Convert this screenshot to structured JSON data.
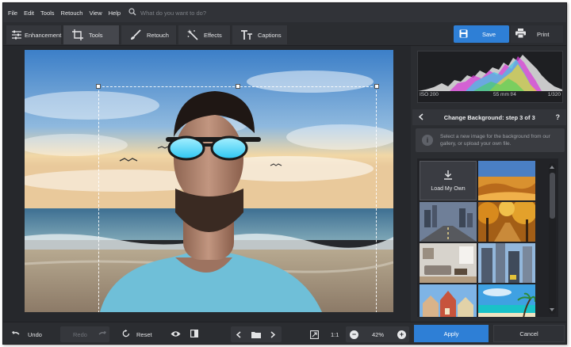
{
  "menu": {
    "items": [
      "File",
      "Edit",
      "Tools",
      "Retouch",
      "View",
      "Help"
    ],
    "search_placeholder": "What do you want to do?"
  },
  "toolbar": {
    "tabs": [
      {
        "label": "Enhancement",
        "icon": "sliders-icon"
      },
      {
        "label": "Tools",
        "icon": "crop-icon",
        "active": true
      },
      {
        "label": "Retouch",
        "icon": "brush-icon"
      },
      {
        "label": "Effects",
        "icon": "magic-wand-icon"
      },
      {
        "label": "Captions",
        "icon": "text-icon"
      }
    ],
    "save_label": "Save",
    "print_label": "Print"
  },
  "histogram": {
    "iso": "ISO 200",
    "lens": "55 mm f/4",
    "shutter": "1/320"
  },
  "panel": {
    "step_title": "Change Background: step 3 of 3",
    "help": "?",
    "hint": "Select a new image for the background from our gallery, or upload your own file.",
    "load_own_label": "Load My Own",
    "gallery": [
      "desert-thumbnail",
      "city-road-thumbnail",
      "autumn-forest-thumbnail",
      "living-room-thumbnail",
      "skyscrapers-thumbnail",
      "old-town-thumbnail",
      "tropical-beach-thumbnail"
    ]
  },
  "bottombar": {
    "undo_label": "Undo",
    "redo_label": "Redo",
    "reset_label": "Reset",
    "zoom_ratio": "1:1",
    "zoom_percent": "42%",
    "apply_label": "Apply",
    "cancel_label": "Cancel"
  },
  "colors": {
    "accent": "#2e7fd6",
    "background": "#2b2d31"
  }
}
